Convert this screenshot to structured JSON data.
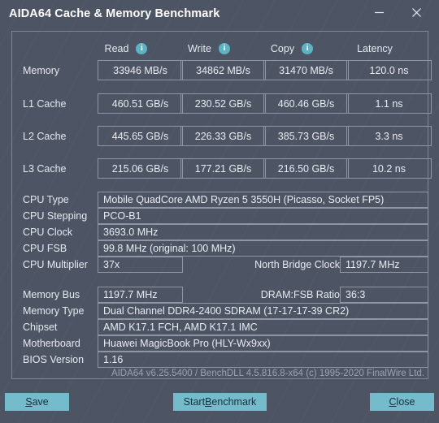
{
  "window": {
    "title": "AIDA64 Cache & Memory Benchmark",
    "controls": {
      "minimize": "minimize-button",
      "close": "close-button"
    }
  },
  "table": {
    "columns": [
      {
        "label": "Read",
        "has_info_icon": true,
        "info_icon": "i"
      },
      {
        "label": "Write",
        "has_info_icon": true,
        "info_icon": "i"
      },
      {
        "label": "Copy",
        "has_info_icon": true,
        "info_icon": "i"
      },
      {
        "label": "Latency",
        "has_info_icon": false,
        "info_icon": ""
      }
    ],
    "rows": [
      {
        "label": "Memory",
        "values": [
          "33946 MB/s",
          "34862 MB/s",
          "31470 MB/s",
          "120.0 ns"
        ]
      },
      {
        "label": "L1 Cache",
        "values": [
          "460.51 GB/s",
          "230.52 GB/s",
          "460.46 GB/s",
          "1.1 ns"
        ]
      },
      {
        "label": "L2 Cache",
        "values": [
          "445.65 GB/s",
          "226.33 GB/s",
          "385.73 GB/s",
          "3.3 ns"
        ]
      },
      {
        "label": "L3 Cache",
        "values": [
          "215.06 GB/s",
          "177.21 GB/s",
          "216.50 GB/s",
          "10.2 ns"
        ]
      }
    ]
  },
  "cpu_info": {
    "cpu_type": {
      "label": "CPU Type",
      "value": "Mobile QuadCore AMD Ryzen 5 3550H  (Picasso, Socket FP5)"
    },
    "cpu_stepping": {
      "label": "CPU Stepping",
      "value": "PCO-B1"
    },
    "cpu_clock": {
      "label": "CPU Clock",
      "value": "3693.0 MHz"
    },
    "cpu_fsb": {
      "label": "CPU FSB",
      "value": "99.8 MHz  (original: 100 MHz)"
    },
    "cpu_multiplier": {
      "label": "CPU Multiplier",
      "value": "37x"
    },
    "north_bridge": {
      "label": "North Bridge Clock",
      "value": "1197.7 MHz"
    }
  },
  "memory_info": {
    "memory_bus": {
      "label": "Memory Bus",
      "value": "1197.7 MHz"
    },
    "dram_fsb": {
      "label": "DRAM:FSB Ratio",
      "value": "36:3"
    },
    "memory_type": {
      "label": "Memory Type",
      "value": "Dual Channel DDR4-2400 SDRAM  (17-17-17-39 CR2)"
    },
    "chipset": {
      "label": "Chipset",
      "value": "AMD K17.1 FCH, AMD K17.1 IMC"
    },
    "motherboard": {
      "label": "Motherboard",
      "value": "Huawei MagicBook Pro (HLY-Wx9xx)"
    },
    "bios_version": {
      "label": "BIOS Version",
      "value": "1.16"
    }
  },
  "credit": "AIDA64 v6.25.5400 / BenchDLL 4.5.816.8-x64  (c) 1995-2020 FinalWire Ltd.",
  "buttons": {
    "save": {
      "accel": "S",
      "rest": "ave"
    },
    "start": {
      "pre": "Start ",
      "accel": "B",
      "rest": "enchmark"
    },
    "close": {
      "accel": "C",
      "rest": "lose"
    }
  },
  "colors": {
    "window_bg": "#4d5565",
    "accent": "#74bccb",
    "info_icon": "#5ab4c4",
    "border": "#8e96a4",
    "text": "#e9ecf1",
    "muted_text": "#9aa3b1"
  }
}
